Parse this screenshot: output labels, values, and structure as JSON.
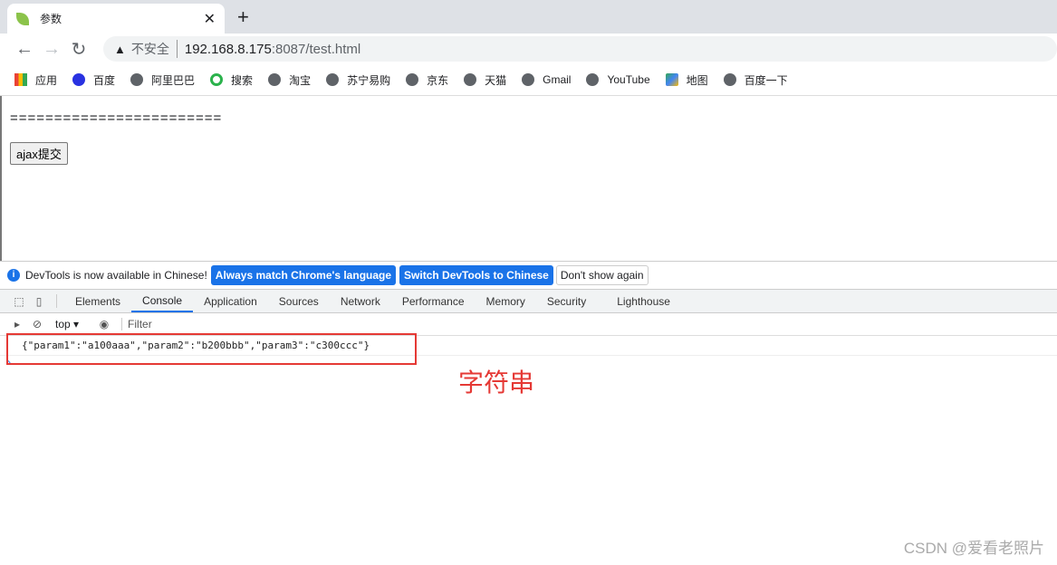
{
  "browser": {
    "tab_title": "参数",
    "url_insecure": "不安全",
    "url_host": "192.168.8.175",
    "url_rest": ":8087/test.html"
  },
  "bookmarks": [
    "应用",
    "百度",
    "阿里巴巴",
    "搜索",
    "淘宝",
    "苏宁易购",
    "京东",
    "天猫",
    "Gmail",
    "YouTube",
    "地图",
    "百度一下"
  ],
  "page": {
    "separator": "========================",
    "button": "ajax提交"
  },
  "devtools": {
    "info": "DevTools is now available in Chinese!",
    "btn_match": "Always match Chrome's language",
    "btn_switch": "Switch DevTools to Chinese",
    "btn_dismiss": "Don't show again",
    "tabs": [
      "Elements",
      "Console",
      "Application",
      "Sources",
      "Network",
      "Performance",
      "Memory",
      "Security",
      "Lighthouse"
    ],
    "context": "top",
    "filter_placeholder": "Filter",
    "log": "{\"param1\":\"a100aaa\",\"param2\":\"b200bbb\",\"param3\":\"c300ccc\"}"
  },
  "annotation": "字符串",
  "watermark": "CSDN @爱看老照片"
}
